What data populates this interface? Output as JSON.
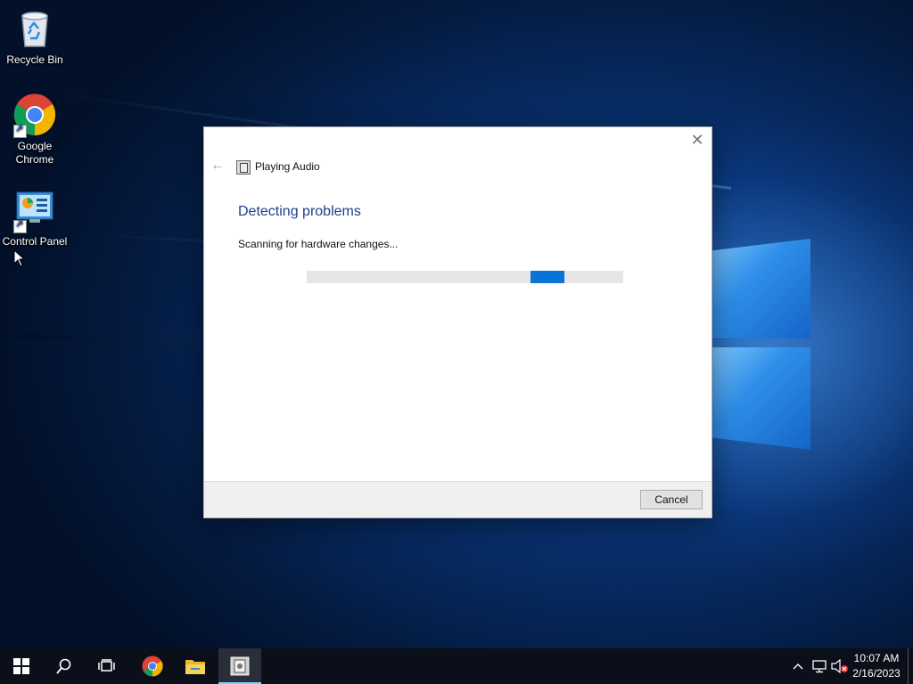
{
  "desktop": {
    "icons": [
      {
        "label": "Recycle Bin"
      },
      {
        "label": "Google Chrome"
      },
      {
        "label": "Control Panel"
      }
    ]
  },
  "dialog": {
    "title": "Playing Audio",
    "heading": "Detecting problems",
    "status": "Scanning for hardware changes...",
    "cancel_label": "Cancel",
    "progress_mode": "indeterminate"
  },
  "taskbar": {
    "items": [
      "windows-start",
      "search",
      "task-view",
      "chrome",
      "file-explorer",
      "troubleshooter"
    ],
    "clock": {
      "time": "10:07 AM",
      "date": "2/16/2023"
    }
  },
  "colors": {
    "accent": "#0a74d6",
    "heading": "#1e3f8a",
    "taskbar": "#0b0f1a"
  }
}
